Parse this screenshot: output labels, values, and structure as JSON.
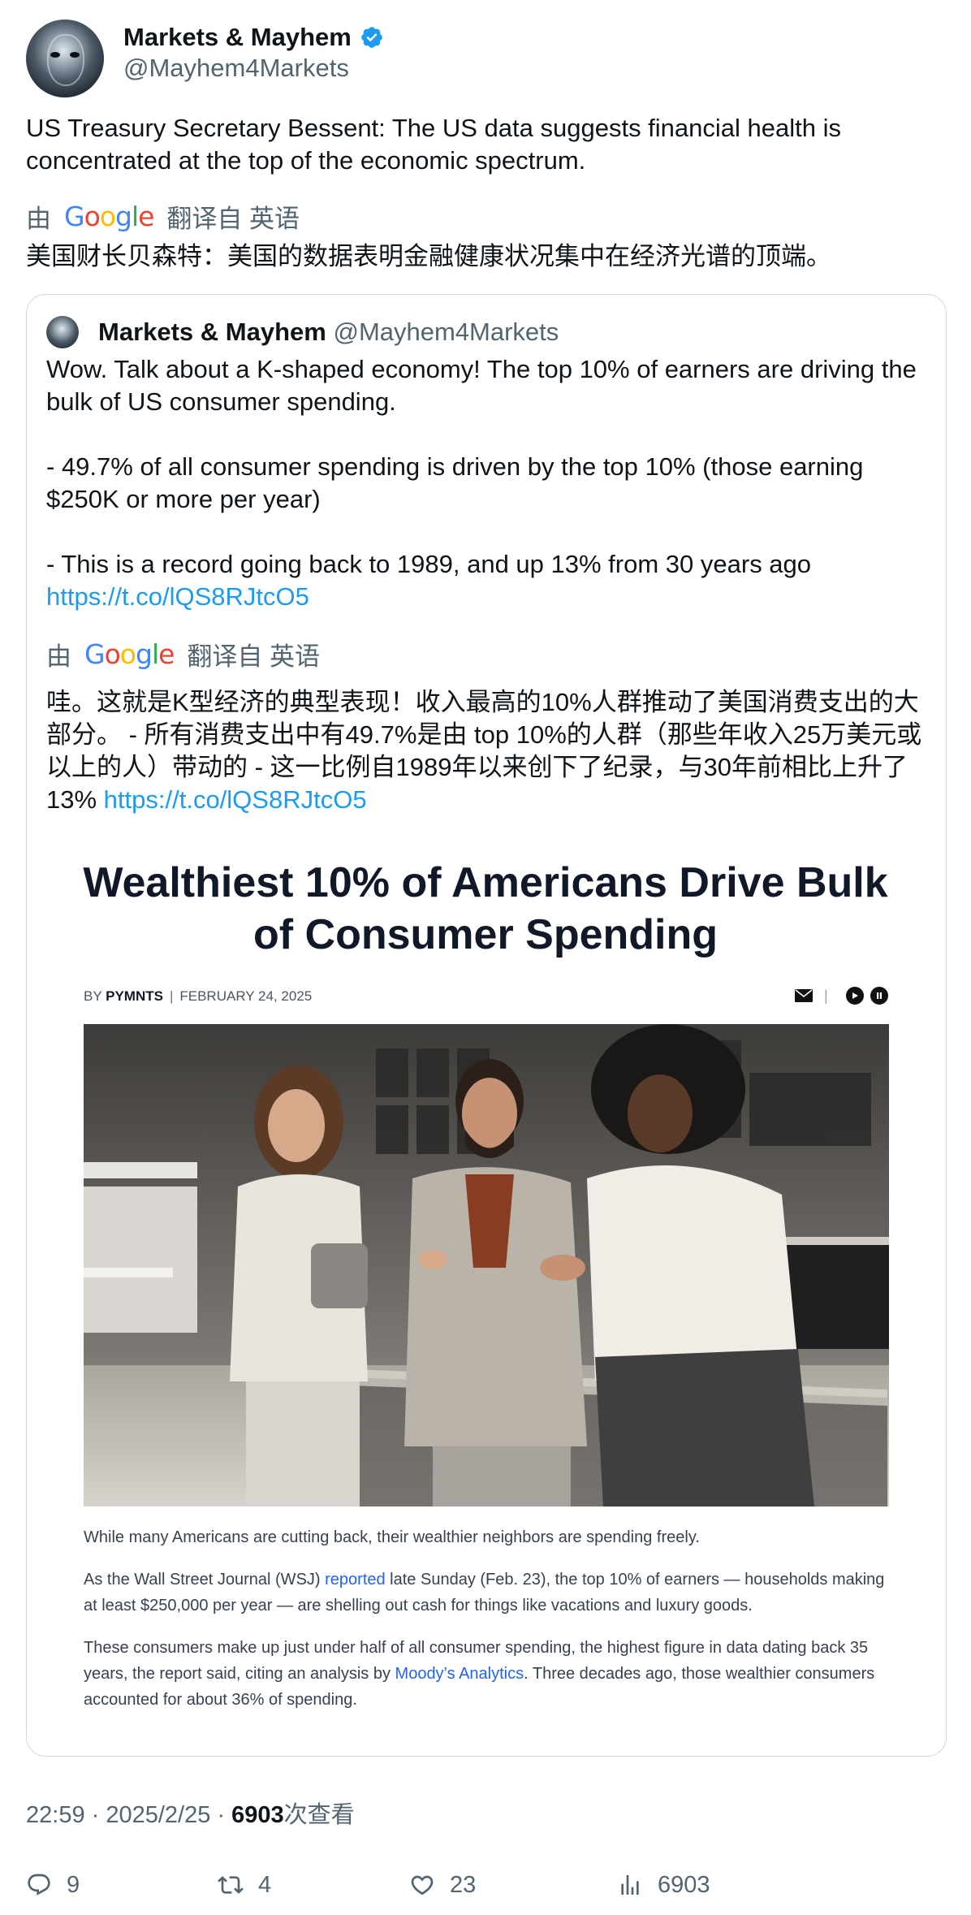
{
  "author": {
    "name": "Markets & Mayhem",
    "handle": "@Mayhem4Markets"
  },
  "tweet": {
    "text": "US Treasury Secretary Bessent: The US data suggests financial health is concentrated at the top of the economic spectrum.",
    "translation": {
      "prefix": "由",
      "google": "Google",
      "suffix": "翻译自 英语",
      "text": "美国财长贝森特：美国的数据表明金融健康状况集中在经济光谱的顶端。"
    }
  },
  "quote": {
    "name": "Markets & Mayhem",
    "handle": "@Mayhem4Markets",
    "para1": "Wow. Talk about a K-shaped economy! The top 10% of earners are driving the bulk of US consumer spending.",
    "para2": "- 49.7% of all consumer spending is driven by the top 10% (those earning $250K or more per year)",
    "para3": "- This is a record going back to 1989, and up 13% from 30 years ago",
    "link": "https://t.co/lQS8RJtcO5",
    "translation": {
      "prefix": "由",
      "google": "Google",
      "suffix": "翻译自 英语",
      "text": "哇。这就是K型经济的典型表现！收入最高的10%人群推动了美国消费支出的大部分。 - 所有消费支出中有49.7%是由 top 10%的人群（那些年收入25万美元或以上的人）带动的 - 这一比例自1989年以来创下了纪录，与30年前相比上升了13%",
      "link": "https://t.co/lQS8RJtcO5"
    },
    "article": {
      "title": "Wealthiest 10% of Americans Drive Bulk of Consumer Spending",
      "by": "BY",
      "author": "PYMNTS",
      "date": "FEBRUARY 24, 2025",
      "caption": "While many Americans are cutting back, their wealthier neighbors are spending freely.",
      "p1_a": "As the Wall Street Journal (WSJ) ",
      "p1_link": "reported",
      "p1_b": " late Sunday (Feb. 23), the top 10% of earners — households making at least $250,000 per year — are shelling out cash for things like vacations and luxury goods.",
      "p2_a": "These consumers make up just under half of all consumer spending, the highest figure in data dating back 35 years, the report said, citing an analysis by ",
      "p2_link": "Moody’s Analytics",
      "p2_b": ". Three decades ago, those wealthier consumers accounted for about 36% of spending."
    }
  },
  "meta": {
    "time": "22:59",
    "date": "2025/2/25",
    "views": "6903",
    "views_label": "次查看"
  },
  "actions": {
    "replies": "9",
    "reposts": "4",
    "likes": "23",
    "views": "6903"
  },
  "colors": {
    "link": "#1d9bf0",
    "secondary_text": "#536471",
    "verified": "#1d9bf0"
  },
  "icons": [
    "verified-badge-icon",
    "google-logo",
    "mail-icon",
    "play-icon",
    "pause-icon",
    "reply-icon",
    "repost-icon",
    "like-icon",
    "views-icon"
  ]
}
